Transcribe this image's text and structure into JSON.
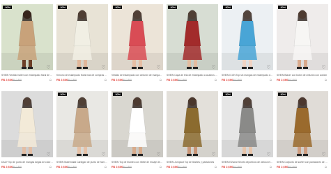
{
  "colors": {
    "price": "#e0362e",
    "badge": "#000000"
  },
  "products": [
    {
      "badge": "-30%",
      "title": "SHEIN Vestido halter con estampado floral de pierna ancha",
      "price": "R$ 2,666",
      "old_price": "R$ 3,809",
      "bg": "#d9e2cc",
      "accent": "#c8a27a",
      "skin": "#6b3f26",
      "icons": [
        "heart-icon",
        "cart-icon"
      ]
    },
    {
      "badge": "-30%",
      "title": "Kimono de estampado floral mas de compras con plisado",
      "price": "R$ 2,666",
      "old_price": "R$ 3,809",
      "bg": "#e8e3d6",
      "accent": "#f1efe4",
      "skin": "#e1b79a",
      "icons": [
        "heart-icon",
        "cart-icon"
      ]
    },
    {
      "badge": "-30%",
      "title": "Vestido de estampado con cinturón de mangas de farol",
      "price": "R$ 2,666",
      "old_price": "R$ 3,809",
      "bg": "#ece4d8",
      "accent": "#d94c55",
      "skin": "#e6bea4",
      "icons": [
        "heart-icon",
        "cart-icon"
      ]
    },
    {
      "badge": "-30%",
      "title": "SHEIN Capa de tela de estampado a cuadros de mujer",
      "price": "R$ 2,666",
      "old_price": "R$ 3,809",
      "bg": "#d7ddd3",
      "accent": "#a22b2b",
      "skin": "#e3bc9f",
      "icons": [
        "heart-icon",
        "cart-icon"
      ]
    },
    {
      "badge": "-30%",
      "title": "SHEIN ICON Top sin mangas de estampado de figura",
      "price": "R$ 2,666",
      "old_price": "R$ 3,809",
      "bg": "#ecf0f3",
      "accent": "#49a5d6",
      "skin": "#f0d4c4",
      "icons": [
        "heart-icon",
        "cart-icon"
      ]
    },
    {
      "badge": "-30%",
      "title": "SHEIN Blazer con botón de cinturón con cordón",
      "price": "R$ 2,666",
      "old_price": "R$ 3,809",
      "bg": "#efeceb",
      "accent": "#f7f6f4",
      "skin": "#d9a98c",
      "icons": [
        "heart-icon",
        "cart-icon"
      ]
    },
    {
      "badge": "",
      "title": "DAZY Top de punto de mangas largas de color liso",
      "price": "R$ 2,666",
      "old_price": "R$ 3,809",
      "bg": "#dcdcdc",
      "accent": "#f3ead8",
      "skin": "#e3bea5",
      "icons": [
        "heart-icon",
        "cart-icon"
      ]
    },
    {
      "badge": "-30%",
      "title": "SHEIN Maternidad Cárdigan de punto de hombros en caída",
      "price": "R$ 2,666",
      "old_price": "R$ 3,809",
      "bg": "#e9e8e4",
      "accent": "#c8a98a",
      "skin": "#e6c1a6",
      "icons": [
        "heart-icon",
        "cart-icon"
      ]
    },
    {
      "badge": "-30%",
      "title": "SHEIN Top de tirantes con ribete de encaje de punto",
      "price": "R$ 2,666",
      "old_price": "R$ 3,809",
      "bg": "#d9d7d0",
      "accent": "#ffffff",
      "skin": "#d8ab8b",
      "icons": [
        "heart-icon",
        "cart-icon"
      ]
    },
    {
      "badge": "",
      "title": "SHEIN Jumpsuit Top de tirantes y pantalones",
      "price": "R$ 2,666",
      "old_price": "R$ 3,809",
      "bg": "#e3e0da",
      "accent": "#8b6b2f",
      "skin": "#c99576",
      "icons": [
        "heart-icon",
        "cart-icon"
      ]
    },
    {
      "badge": "-30%",
      "title": "SHEIN EZwear Shorts deportivos de cintura elástica",
      "price": "R$ 2,666",
      "old_price": "R$ 3,809",
      "bg": "#e6e6e6",
      "accent": "#8a8a88",
      "skin": "#e7c4aa",
      "icons": [
        "heart-icon",
        "cart-icon"
      ]
    },
    {
      "badge": "-30%",
      "title": "SHEIN Conjunto de suéter con pantalones de punto",
      "price": "R$ 2,666",
      "old_price": "R$ 3,809",
      "bg": "#e0dcd7",
      "accent": "#9a6a2d",
      "skin": "#cf9d80",
      "icons": [
        "heart-icon",
        "cart-icon"
      ]
    }
  ]
}
